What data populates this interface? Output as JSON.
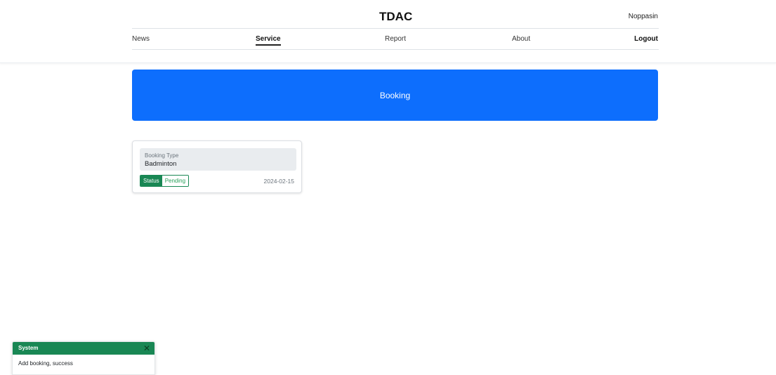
{
  "header": {
    "brand": "TDAC",
    "user": "Noppasin",
    "nav": {
      "news": "News",
      "service": "Service",
      "report": "Report",
      "about": "About",
      "logout": "Logout"
    },
    "active_nav": "Service"
  },
  "hero": {
    "title": "Booking"
  },
  "booking_card": {
    "type_label": "Booking Type",
    "type_value": "Badminton",
    "status_label": "Status",
    "status_value": "Pending",
    "date": "2024-02-15"
  },
  "toast": {
    "title": "System",
    "close": "✕",
    "message": "Add booking, success"
  },
  "colors": {
    "primary": "#0d6efd",
    "success": "#198754",
    "card_field_bg": "#e9ecef"
  }
}
